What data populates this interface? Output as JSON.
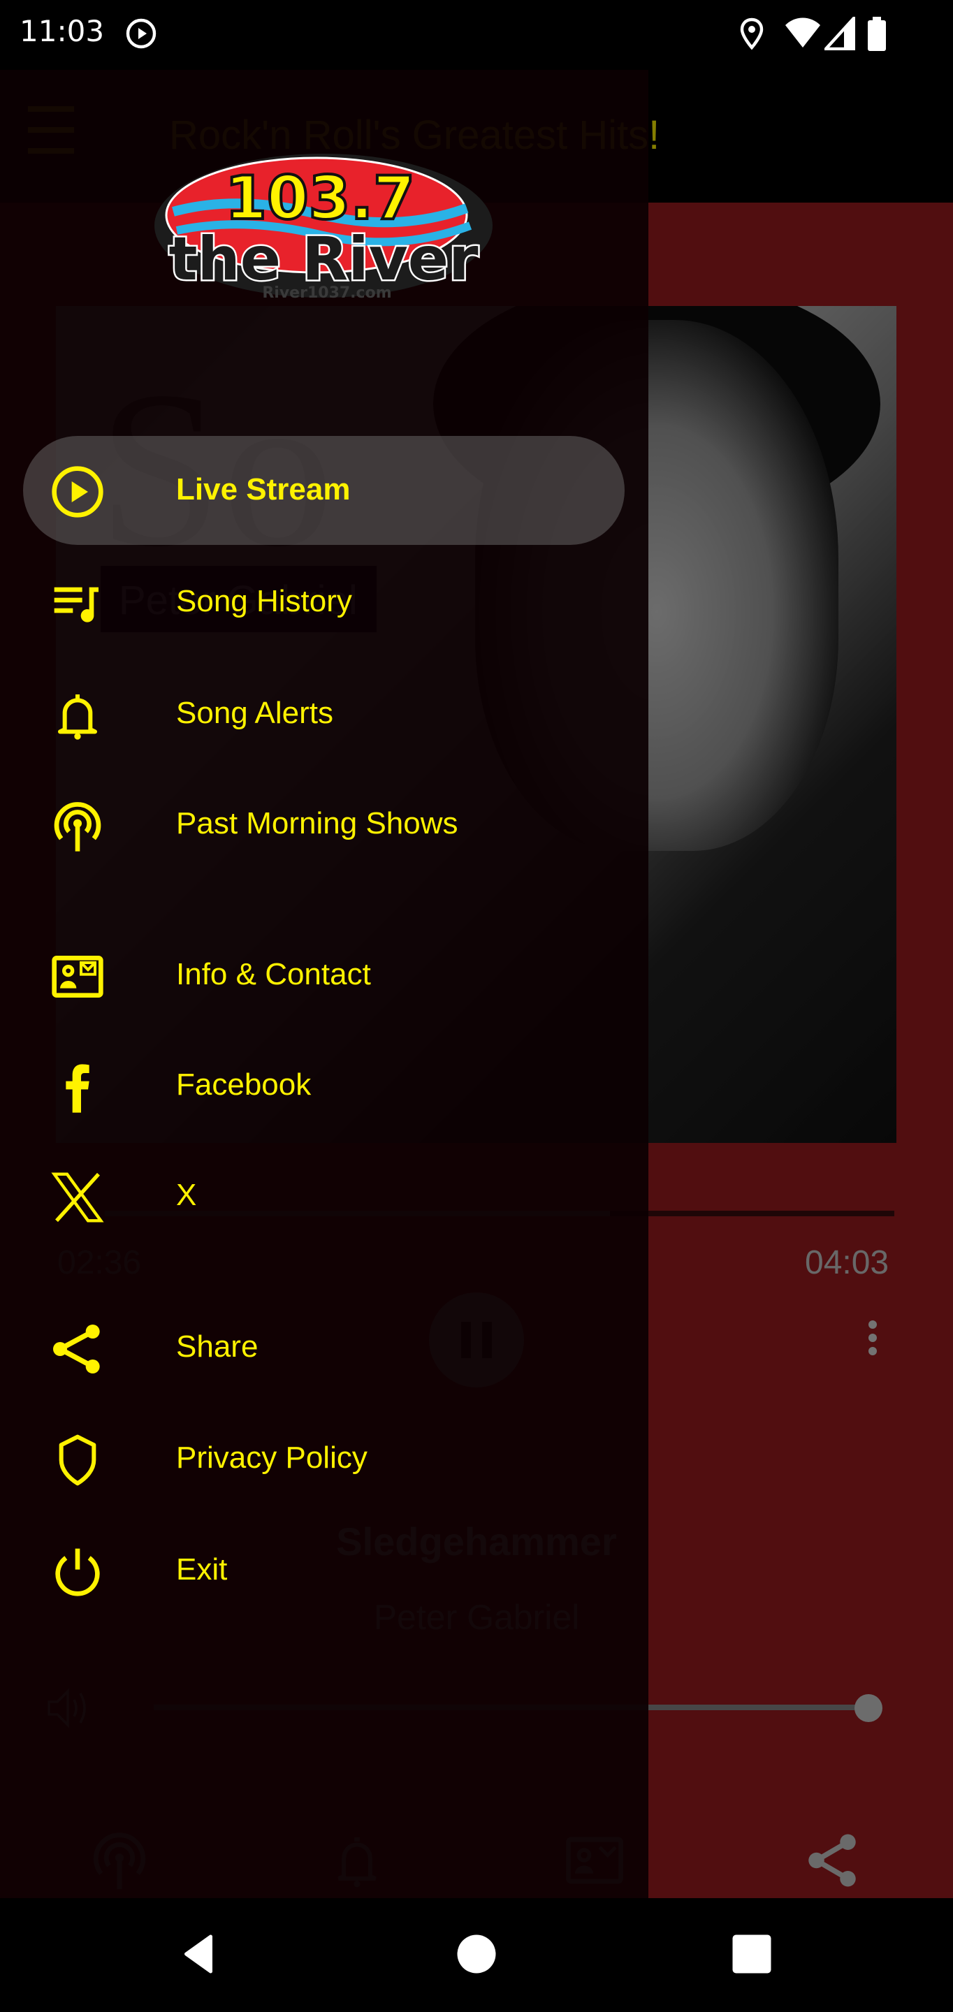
{
  "status_bar": {
    "time": "11:03",
    "icons": [
      "play-circle-icon",
      "location-icon",
      "wifi-icon",
      "signal-icon",
      "battery-icon"
    ]
  },
  "app_bar": {
    "menu_icon": "hamburger-menu-icon",
    "title": "Rock'n Roll's Greatest Hits!"
  },
  "player": {
    "album_text": "So",
    "album_artist_label": "Peter Gabriel",
    "elapsed": "02:36",
    "duration": "04:03",
    "progress": 0.64,
    "song_title": "Sledgehammer",
    "artist": "Peter Gabriel",
    "volume": 1.0,
    "play_state_icon": "pause-icon",
    "more_icon": "more-vert-icon"
  },
  "bottom_tabs": [
    {
      "icon": "podcast-icon"
    },
    {
      "icon": "bell-icon"
    },
    {
      "icon": "contact-card-icon"
    },
    {
      "icon": "share-icon"
    }
  ],
  "drawer": {
    "logo": {
      "line1": "103.7",
      "line2": "the River",
      "url_text": "River1037.com"
    },
    "items": [
      {
        "label": "Live Stream",
        "icon": "play-circle-icon",
        "active": true
      },
      {
        "label": "Song History",
        "icon": "queue-music-icon",
        "active": false
      },
      {
        "label": "Song Alerts",
        "icon": "bell-icon",
        "active": false
      },
      {
        "label": "Past Morning Shows",
        "icon": "podcast-icon",
        "active": false
      },
      {
        "label": "Info & Contact",
        "icon": "contact-card-icon",
        "active": false
      },
      {
        "label": "Facebook",
        "icon": "facebook-icon",
        "active": false
      },
      {
        "label": "X",
        "icon": "x-logo-icon",
        "active": false
      },
      {
        "label": "Share",
        "icon": "share-icon",
        "active": false
      },
      {
        "label": "Privacy Policy",
        "icon": "shield-icon",
        "active": false
      },
      {
        "label": "Exit",
        "icon": "power-icon",
        "active": false
      }
    ]
  },
  "colors": {
    "accent": "#fff200",
    "background_red": "#9b1b1f",
    "drawer_bg": "#0c0002"
  },
  "nav_bar": {
    "buttons": [
      "back-icon",
      "home-icon",
      "recents-icon"
    ]
  }
}
